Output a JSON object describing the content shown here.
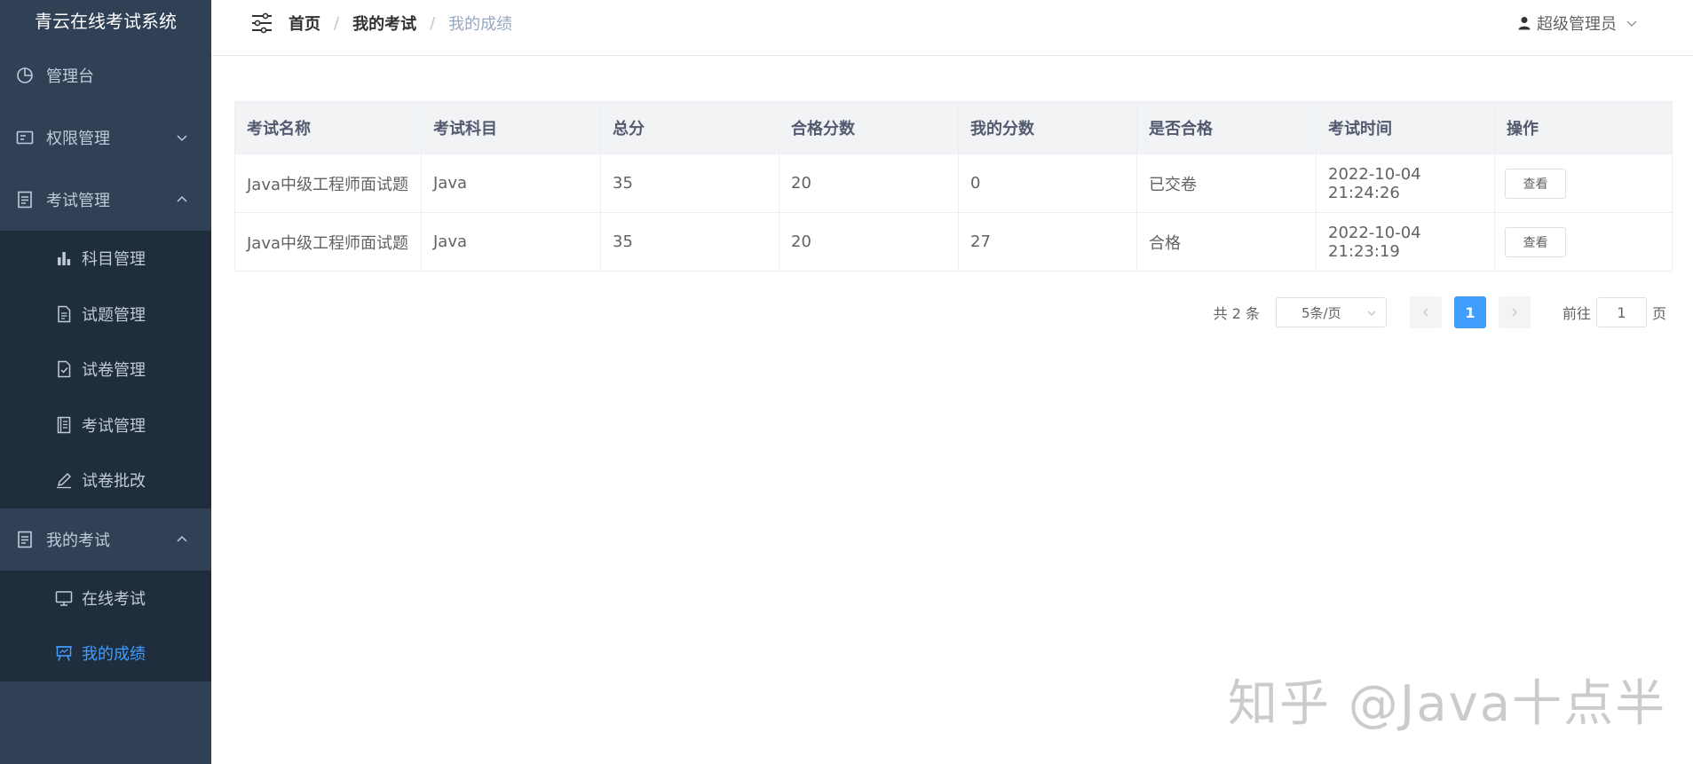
{
  "app": {
    "title": "青云在线考试系统"
  },
  "sidebar": {
    "items": [
      {
        "label": "管理台",
        "icon": "pie-chart-icon"
      },
      {
        "label": "权限管理",
        "icon": "id-card-icon",
        "expanded": false
      },
      {
        "label": "考试管理",
        "icon": "document-icon",
        "expanded": true,
        "children": [
          {
            "label": "科目管理",
            "icon": "bar-chart-icon"
          },
          {
            "label": "试题管理",
            "icon": "file-text-icon"
          },
          {
            "label": "试卷管理",
            "icon": "file-check-icon"
          },
          {
            "label": "考试管理",
            "icon": "notebook-icon"
          },
          {
            "label": "试卷批改",
            "icon": "edit-pen-icon"
          }
        ]
      },
      {
        "label": "我的考试",
        "icon": "document-icon",
        "expanded": true,
        "children": [
          {
            "label": "在线考试",
            "icon": "monitor-icon"
          },
          {
            "label": "我的成绩",
            "icon": "presentation-board-icon",
            "active": true
          }
        ]
      }
    ]
  },
  "header": {
    "breadcrumb": [
      "首页",
      "我的考试",
      "我的成绩"
    ],
    "user": "超级管理员"
  },
  "table": {
    "columns": [
      "考试名称",
      "考试科目",
      "总分",
      "合格分数",
      "我的分数",
      "是否合格",
      "考试时间",
      "操作"
    ],
    "rows": [
      {
        "name": "Java中级工程师面试题",
        "subject": "Java",
        "total": "35",
        "pass_score": "20",
        "my_score": "0",
        "status": "已交卷",
        "time": "2022-10-04 21:24:26",
        "action": "查看"
      },
      {
        "name": "Java中级工程师面试题",
        "subject": "Java",
        "total": "35",
        "pass_score": "20",
        "my_score": "27",
        "status": "合格",
        "time": "2022-10-04 21:23:19",
        "action": "查看"
      }
    ]
  },
  "pagination": {
    "total_text": "共 2 条",
    "page_size": "5条/页",
    "current_page": "1",
    "goto_prefix": "前往",
    "goto_value": "1",
    "goto_suffix": "页"
  },
  "watermark": "知乎 @Java十点半",
  "colors": {
    "sidebar_bg": "#304156",
    "submenu_bg": "#1f2d3d",
    "accent": "#409eff"
  }
}
